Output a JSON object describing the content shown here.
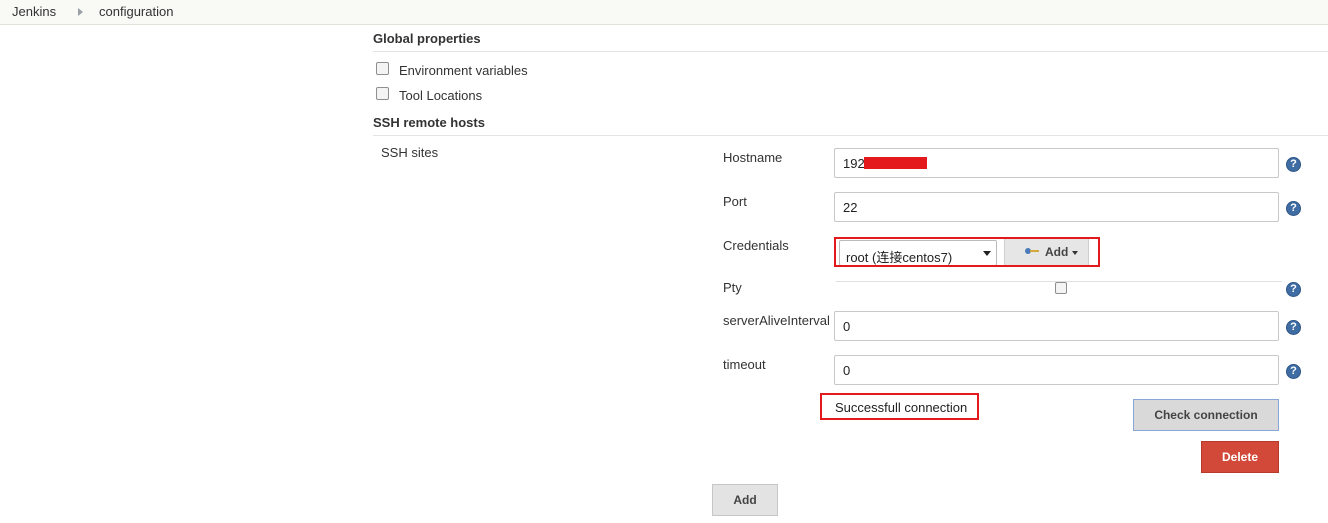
{
  "breadcrumb": {
    "items": [
      "Jenkins",
      "configuration"
    ]
  },
  "global_properties": {
    "title": "Global properties",
    "checkboxes": [
      "Environment variables",
      "Tool Locations"
    ]
  },
  "ssh_remote_hosts": {
    "title": "SSH remote hosts",
    "sites_label": "SSH sites",
    "hostname": {
      "label": "Hostname",
      "value": "192."
    },
    "port": {
      "label": "Port",
      "value": "22"
    },
    "credentials": {
      "label": "Credentials",
      "selected": "root (连接centos7)",
      "add_label": "Add"
    },
    "pty": {
      "label": "Pty"
    },
    "server_alive_interval": {
      "label": "serverAliveInterval",
      "value": "0"
    },
    "timeout": {
      "label": "timeout",
      "value": "0"
    },
    "status_message": "Successfull connection",
    "check_button": "Check connection",
    "delete_button": "Delete",
    "add_button": "Add",
    "help_glyph": "?"
  },
  "colors": {
    "annotation_red": "#e4191c",
    "delete_red": "#d24939",
    "help_blue": "#3f6da3",
    "breadcrumb_bg": "#f9faf5"
  },
  "icons": {
    "breadcrumb_separator": "triangle-right-icon",
    "help": "question-circle-icon",
    "credentials_add": "key-icon",
    "dropdown": "caret-down-icon"
  }
}
